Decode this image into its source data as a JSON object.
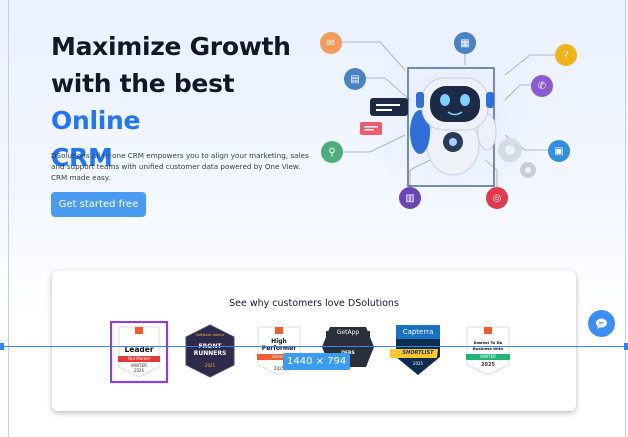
{
  "hero": {
    "title_line1": "Maximize Growth",
    "title_line2_prefix": "with the best ",
    "title_accent": "Online",
    "title_line3": "CRM",
    "description": "DSolutions all-in-one CRM empowers you to align your marketing, sales and support teams with unified customer data powered by One View. CRM made easy.",
    "cta_label": "Get started free"
  },
  "reviews": {
    "title": "See why customers love DSolutions",
    "badges": [
      {
        "name": "g2-leader",
        "line1": "Leader",
        "line2": "Mid-Market",
        "line3": "WINTER",
        "year": "2025"
      },
      {
        "name": "software-advice",
        "line1": "Software Advice",
        "line2": "FRONT RUNNERS",
        "year": "2025"
      },
      {
        "name": "g2-high-performer",
        "line1": "High",
        "line2": "Performer",
        "line3": "Enterp",
        "year": "2025"
      },
      {
        "name": "getapp",
        "line1": "GetApp",
        "line2": "DERS"
      },
      {
        "name": "capterra",
        "line1": "Capterra",
        "line2": "SHORTLIST",
        "year": "2025"
      },
      {
        "name": "g2-easiest",
        "line1": "Easiest To Do",
        "line2": "Business With",
        "line3": "WINTER",
        "year": "2025"
      }
    ]
  },
  "overlay": {
    "dimension_label": "1440 × 794"
  },
  "colors": {
    "accent": "#1f75fe",
    "cta": "#4a9bf2",
    "selection": "#8b3fe0"
  },
  "icons": [
    "chat-icon",
    "robot-illustration"
  ]
}
